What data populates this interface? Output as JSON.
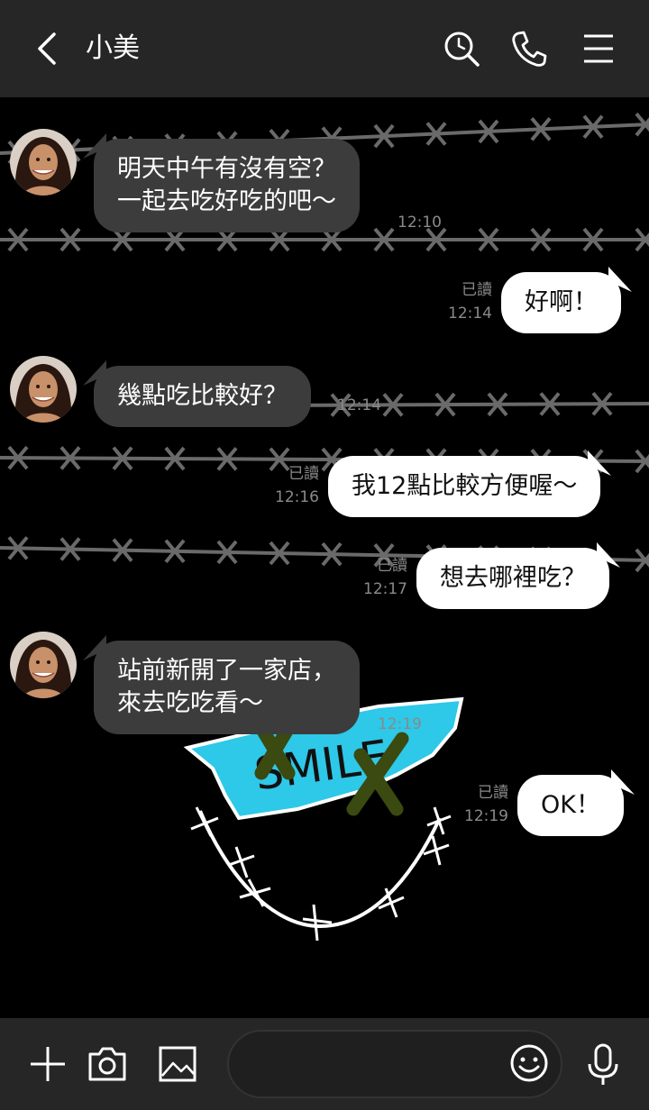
{
  "header": {
    "title": "小美",
    "back_icon": "chevron-left-icon",
    "search_icon": "search-history-icon",
    "call_icon": "phone-icon",
    "menu_icon": "hamburger-menu-icon"
  },
  "messages": [
    {
      "direction": "in",
      "text": "明天中午有沒有空？\n一起去吃好吃的吧～",
      "time": "12:10"
    },
    {
      "direction": "out",
      "text": "好啊！",
      "read": "已讀",
      "time": "12:14"
    },
    {
      "direction": "in",
      "text": "幾點吃比較好？",
      "time": "12:14"
    },
    {
      "direction": "out",
      "text": "我12點比較方便喔～",
      "read": "已讀",
      "time": "12:16"
    },
    {
      "direction": "out",
      "text": "想去哪裡吃？",
      "read": "已讀",
      "time": "12:17"
    },
    {
      "direction": "in",
      "text": "站前新開了一家店，\n來去吃吃看～",
      "time": "12:19"
    },
    {
      "direction": "out",
      "text": "OK！",
      "read": "已讀",
      "time": "12:19"
    }
  ],
  "wallpaper": {
    "text": "SMILE",
    "accent_color": "#2ec8e8",
    "x_color": "#3a4a10",
    "wire_color": "#6a6a6a"
  },
  "footer": {
    "input_value": "",
    "plus_icon": "plus-icon",
    "camera_icon": "camera-icon",
    "image_icon": "image-icon",
    "emoji_icon": "emoji-icon",
    "mic_icon": "microphone-icon"
  }
}
